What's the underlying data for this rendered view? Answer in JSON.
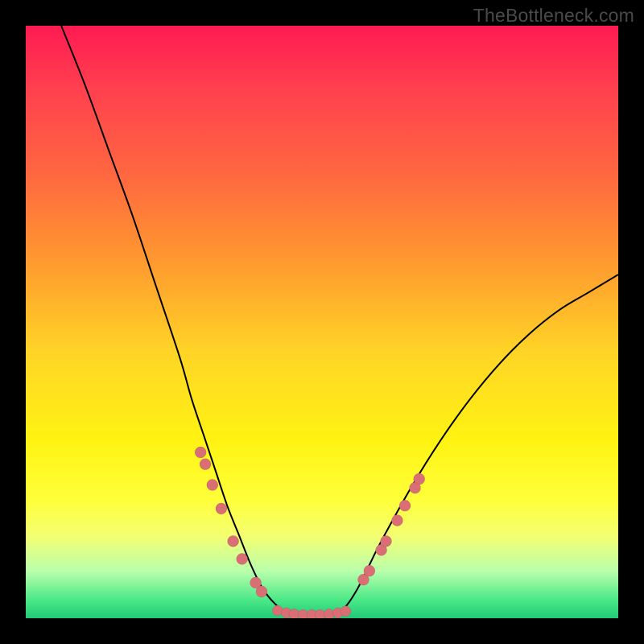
{
  "watermark": "TheBottleneck.com",
  "chart_data": {
    "type": "line",
    "title": "",
    "xlabel": "",
    "ylabel": "",
    "xlim": [
      0,
      100
    ],
    "ylim": [
      0,
      100
    ],
    "grid": false,
    "legend": false,
    "gradient_bands": [
      {
        "color": "#ff1a52",
        "stop": 0
      },
      {
        "color": "#ff3e4f",
        "stop": 10
      },
      {
        "color": "#ff6a3f",
        "stop": 26
      },
      {
        "color": "#ff9a2f",
        "stop": 40
      },
      {
        "color": "#ffd426",
        "stop": 55
      },
      {
        "color": "#fff312",
        "stop": 70
      },
      {
        "color": "#ffff3a",
        "stop": 80
      },
      {
        "color": "#f4ff70",
        "stop": 86
      },
      {
        "color": "#baffac",
        "stop": 92
      },
      {
        "color": "#49e887",
        "stop": 97
      },
      {
        "color": "#22c976",
        "stop": 100
      }
    ],
    "series": [
      {
        "name": "bottleneck-curve",
        "x": [
          6,
          10,
          14,
          18,
          22,
          26,
          28,
          30,
          32,
          34,
          36,
          38,
          40,
          42,
          44,
          46,
          48,
          50,
          52,
          54,
          56,
          58,
          60,
          65,
          70,
          75,
          80,
          85,
          90,
          95,
          100
        ],
        "y": [
          100,
          90,
          79,
          68,
          56,
          44,
          37,
          31,
          25,
          19,
          14,
          9,
          5,
          2.5,
          1,
          0.5,
          0.5,
          0.5,
          0.8,
          2,
          5,
          9,
          13,
          22,
          30,
          37,
          43,
          48,
          52,
          55,
          58
        ]
      }
    ],
    "marker_points_left": [
      {
        "x": 29.5,
        "y": 28
      },
      {
        "x": 30.3,
        "y": 26
      },
      {
        "x": 31.5,
        "y": 22.5
      },
      {
        "x": 33.0,
        "y": 18.5
      },
      {
        "x": 35.0,
        "y": 13
      },
      {
        "x": 36.5,
        "y": 10
      },
      {
        "x": 38.8,
        "y": 6
      },
      {
        "x": 39.8,
        "y": 4.5
      }
    ],
    "marker_points_bottom": [
      {
        "x": 42.5,
        "y": 1.3
      },
      {
        "x": 44.0,
        "y": 0.9
      },
      {
        "x": 45.3,
        "y": 0.7
      },
      {
        "x": 46.8,
        "y": 0.6
      },
      {
        "x": 48.3,
        "y": 0.6
      },
      {
        "x": 49.7,
        "y": 0.6
      },
      {
        "x": 51.2,
        "y": 0.7
      },
      {
        "x": 52.7,
        "y": 0.9
      },
      {
        "x": 54.0,
        "y": 1.2
      }
    ],
    "marker_points_right": [
      {
        "x": 57.0,
        "y": 6.5
      },
      {
        "x": 58.0,
        "y": 8
      },
      {
        "x": 60.0,
        "y": 11.5
      },
      {
        "x": 60.8,
        "y": 13
      },
      {
        "x": 62.7,
        "y": 16.5
      },
      {
        "x": 64.0,
        "y": 19
      },
      {
        "x": 65.7,
        "y": 22
      },
      {
        "x": 66.4,
        "y": 23.5
      }
    ]
  }
}
